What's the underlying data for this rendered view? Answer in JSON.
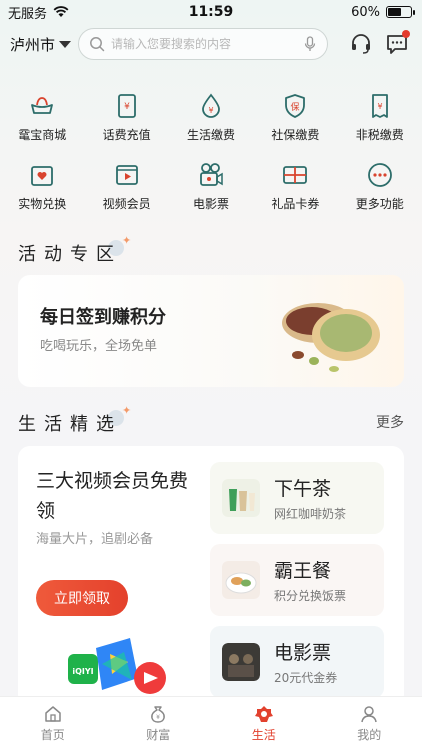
{
  "status": {
    "carrier": "无服务",
    "time": "11:59",
    "battery": "60%",
    "battery_level": 0.6
  },
  "header": {
    "city": "泸州市",
    "search_placeholder": "请输入您要搜索的内容",
    "has_unread": true
  },
  "services": [
    {
      "label": "鼋宝商城",
      "icon": "ingot-icon"
    },
    {
      "label": "话费充值",
      "icon": "phone-bill-icon"
    },
    {
      "label": "生活缴费",
      "icon": "utility-drop-icon"
    },
    {
      "label": "社保缴费",
      "icon": "social-security-shield-icon"
    },
    {
      "label": "非税缴费",
      "icon": "receipt-icon"
    },
    {
      "label": "实物兑换",
      "icon": "gift-box-icon"
    },
    {
      "label": "视频会员",
      "icon": "video-play-icon"
    },
    {
      "label": "电影票",
      "icon": "film-camera-icon"
    },
    {
      "label": "礼品卡券",
      "icon": "gift-card-icon"
    },
    {
      "label": "更多功能",
      "icon": "more-dots-icon"
    }
  ],
  "activity": {
    "section_title": "活动专区",
    "card_title": "每日签到赚积分",
    "card_subtitle": "吃喝玩乐，全场免单"
  },
  "life": {
    "section_title": "生活精选",
    "more": "更多",
    "vip_title": "三大视频会员免费领",
    "vip_subtitle": "海量大片，追剧必备",
    "claim_button": "立即领取",
    "iqiyi_logo_text": "iQIYI",
    "offers": [
      {
        "title": "下午茶",
        "subtitle": "网红咖啡奶茶",
        "bg": "#f7f8f2"
      },
      {
        "title": "霸王餐",
        "subtitle": "积分兑换饭票",
        "bg": "#faf6f4"
      },
      {
        "title": "电影票",
        "subtitle": "20元代金券",
        "bg": "#f2f6f8"
      }
    ]
  },
  "tabs": [
    {
      "label": "首页",
      "icon": "home-icon",
      "active": false
    },
    {
      "label": "财富",
      "icon": "wealth-bag-icon",
      "active": false
    },
    {
      "label": "生活",
      "icon": "life-icon",
      "active": true
    },
    {
      "label": "我的",
      "icon": "profile-icon",
      "active": false
    }
  ],
  "colors": {
    "accent": "#e2412e",
    "icon_teal": "#2d6d6a",
    "icon_red": "#d9442e"
  }
}
